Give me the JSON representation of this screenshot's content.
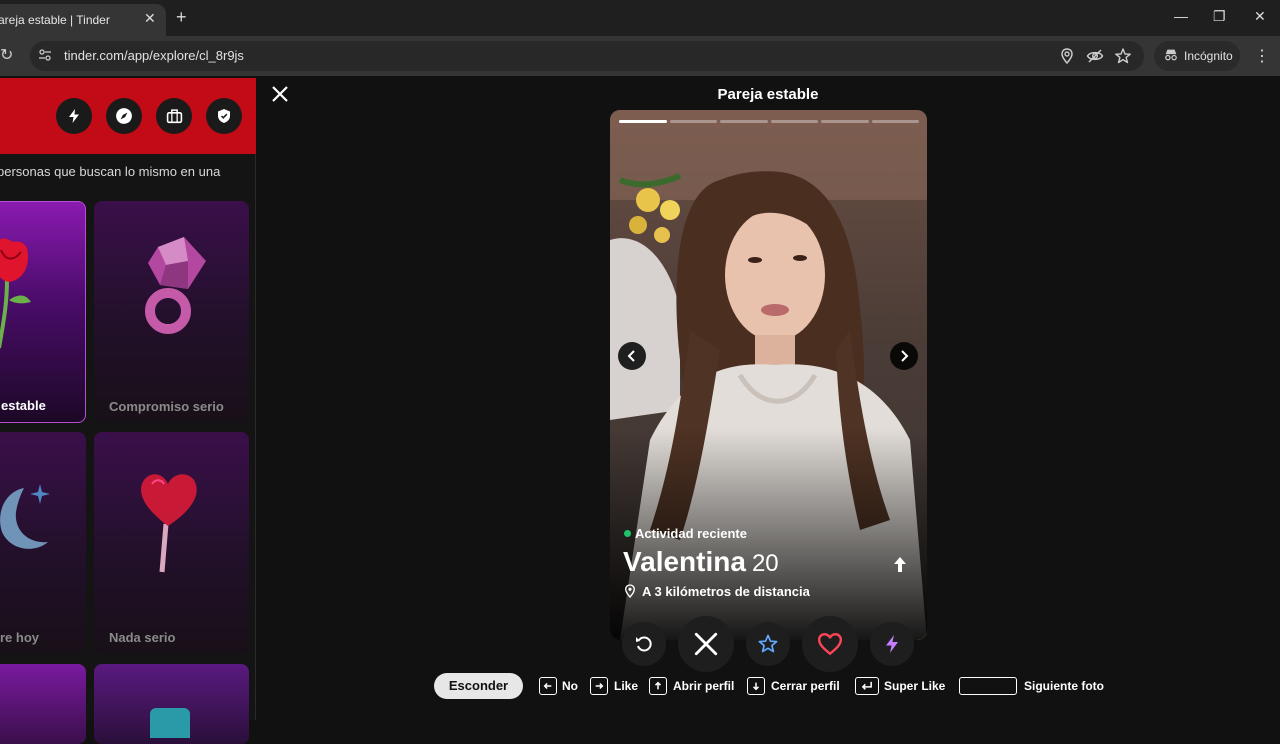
{
  "browser": {
    "tab_title": "Pareja estable | Tinder",
    "url": "tinder.com/app/explore/cl_8r9js",
    "incognito_label": "Incógnito"
  },
  "sidebar": {
    "description": "personas que buscan lo mismo en una",
    "header_icons": [
      "bolt-icon",
      "compass-icon",
      "briefcase-icon",
      "shield-icon"
    ],
    "cards": [
      {
        "label": "estable"
      },
      {
        "label": "Compromiso serio"
      },
      {
        "label": "re hoy"
      },
      {
        "label": "Nada serio"
      }
    ]
  },
  "main": {
    "title": "Pareja estable",
    "photo_count": 6,
    "active_photo": 1,
    "profile": {
      "activity": "Actividad reciente",
      "name": "Valentina",
      "age": "20",
      "distance": "A 3 kilómetros de distancia"
    },
    "actions": [
      "rewind-icon",
      "nope-icon",
      "super-like-icon",
      "like-icon",
      "boost-icon"
    ]
  },
  "hints": {
    "hide": "Esconder",
    "no": "No",
    "like": "Like",
    "open_profile": "Abrir perfil",
    "close_profile": "Cerrar perfil",
    "super_like": "Super Like",
    "next_photo": "Siguiente foto"
  },
  "colors": {
    "brand_red": "#c20b17",
    "like_red": "#ff4458",
    "super_like_blue": "#5fa8ff",
    "boost_purple": "#c77dff",
    "online_green": "#1ec36b"
  }
}
